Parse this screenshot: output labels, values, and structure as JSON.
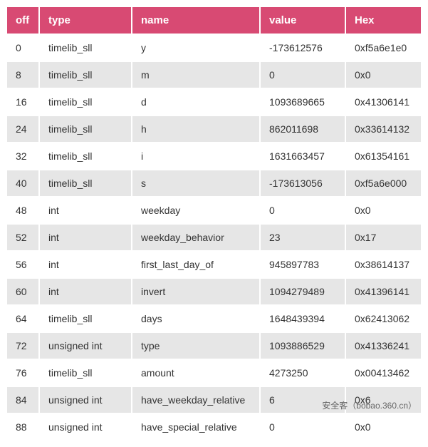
{
  "columns": [
    "off",
    "type",
    "name",
    "value",
    "Hex"
  ],
  "rows": [
    {
      "off": "0",
      "type": "timelib_sll",
      "name": "y",
      "value": "-173612576",
      "hex": "0xf5a6e1e0"
    },
    {
      "off": "8",
      "type": "timelib_sll",
      "name": "m",
      "value": "0",
      "hex": "0x0"
    },
    {
      "off": "16",
      "type": "timelib_sll",
      "name": "d",
      "value": "1093689665",
      "hex": "0x41306141"
    },
    {
      "off": "24",
      "type": "timelib_sll",
      "name": "h",
      "value": "862011698",
      "hex": "0x33614132"
    },
    {
      "off": "32",
      "type": "timelib_sll",
      "name": "i",
      "value": "1631663457",
      "hex": "0x61354161"
    },
    {
      "off": "40",
      "type": "timelib_sll",
      "name": "s",
      "value": "-173613056",
      "hex": "0xf5a6e000"
    },
    {
      "off": "48",
      "type": "int",
      "name": "weekday",
      "value": "0",
      "hex": "0x0"
    },
    {
      "off": "52",
      "type": "int",
      "name": "weekday_behavior",
      "value": "23",
      "hex": "0x17"
    },
    {
      "off": "56",
      "type": "int",
      "name": "first_last_day_of",
      "value": "945897783",
      "hex": "0x38614137"
    },
    {
      "off": "60",
      "type": "int",
      "name": "invert",
      "value": "1094279489",
      "hex": "0x41396141"
    },
    {
      "off": "64",
      "type": "timelib_sll",
      "name": "days",
      "value": "1648439394",
      "hex": "0x62413062"
    },
    {
      "off": "72",
      "type": "unsigned int",
      "name": "type",
      "value": "1093886529",
      "hex": "0x41336241"
    },
    {
      "off": "76",
      "type": "timelib_sll",
      "name": "amount",
      "value": "4273250",
      "hex": "0x00413462"
    },
    {
      "off": "84",
      "type": "unsigned int",
      "name": "have_weekday_relative",
      "value": "6",
      "hex": "0x6"
    },
    {
      "off": "88",
      "type": "unsigned int",
      "name": "have_special_relative",
      "value": "0",
      "hex": "0x0"
    }
  ],
  "watermark": "安全客（bobao.360.cn）"
}
